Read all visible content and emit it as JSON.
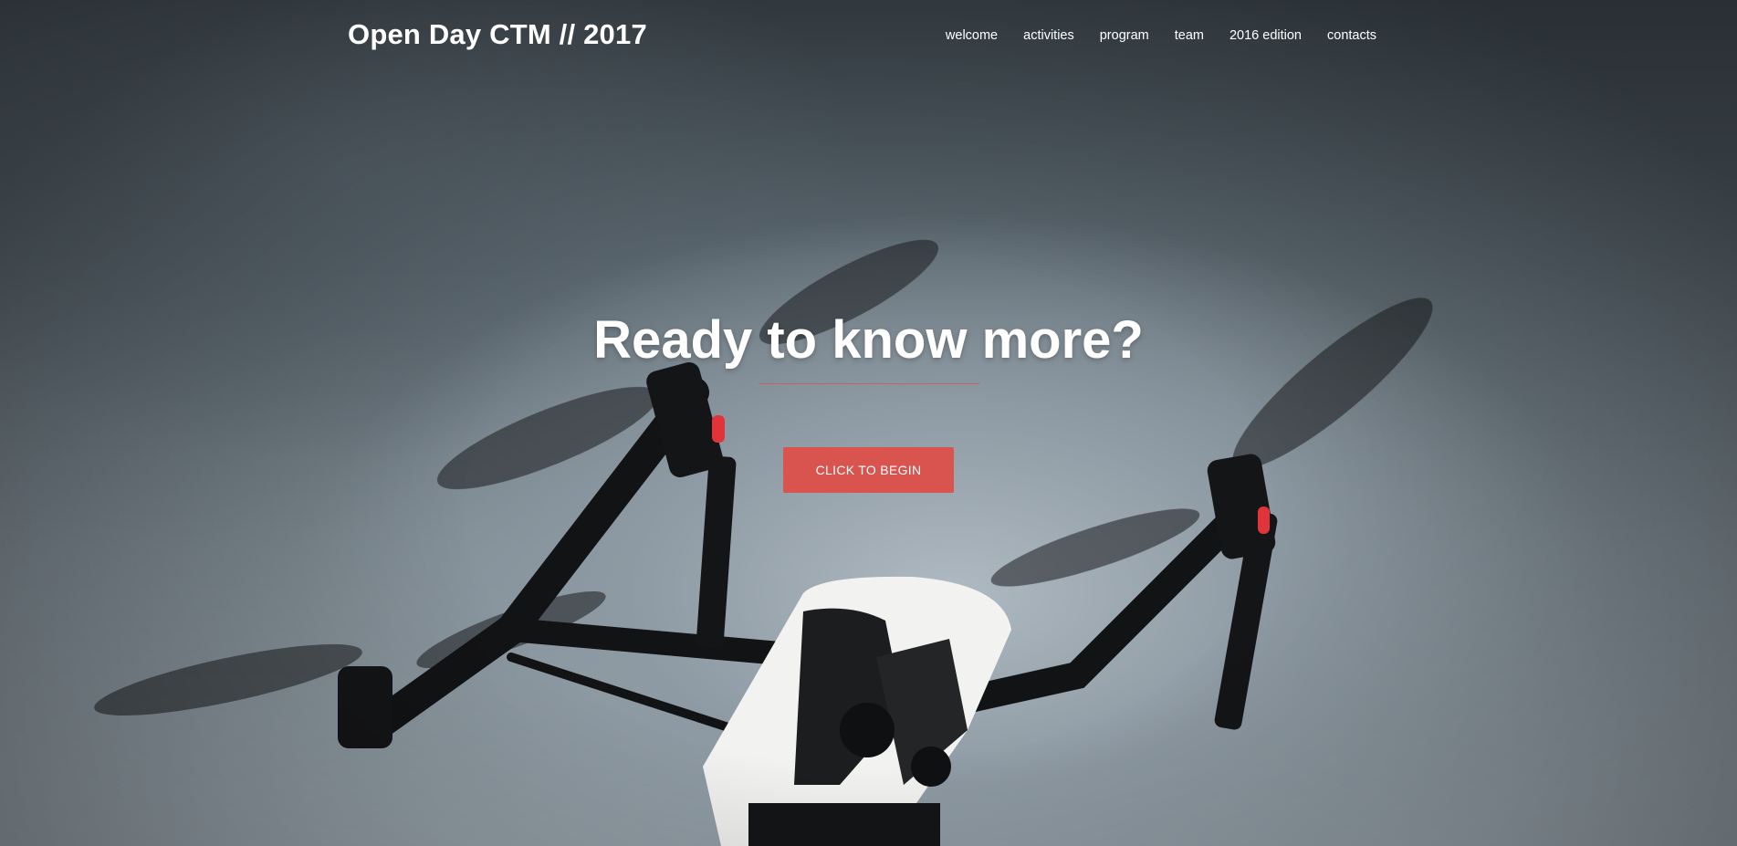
{
  "site": {
    "brand": "Open Day CTM // 2017"
  },
  "nav": {
    "items": [
      {
        "label": "welcome"
      },
      {
        "label": "activities"
      },
      {
        "label": "program"
      },
      {
        "label": "team"
      },
      {
        "label": "2016 edition"
      },
      {
        "label": "contacts"
      }
    ]
  },
  "hero": {
    "headline": "Ready to know more?",
    "cta_label": "CLICK TO BEGIN",
    "background_subject": "drone-photo"
  },
  "colors": {
    "accent": "#d9534f",
    "text": "#ffffff",
    "sky_dark": "#3f4950",
    "sky_light": "#aeb9c1"
  }
}
